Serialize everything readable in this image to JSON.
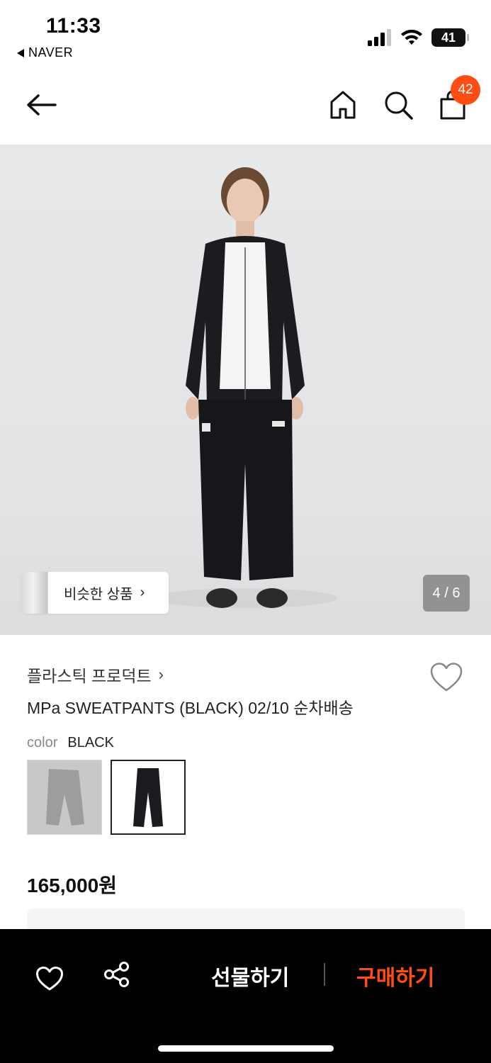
{
  "status_bar": {
    "time": "11:33",
    "back_app": "NAVER",
    "battery": "41"
  },
  "nav": {
    "cart_count": "42",
    "icons": [
      "back-arrow-icon",
      "home-icon",
      "search-icon",
      "shopping-bag-icon"
    ]
  },
  "gallery": {
    "similar_label": "비슷한 상품",
    "similar_chevron": "›",
    "page_indicator": "4 / 6"
  },
  "product": {
    "brand": "플라스틱 프로덕트",
    "brand_chevron": "›",
    "title": "MPa SWEATPANTS (BLACK) 02/10 순차배송",
    "color_key": "color",
    "color_value": "BLACK",
    "swatches": [
      "grey",
      "black"
    ],
    "selected_swatch": "black",
    "price": "165,000원"
  },
  "bottom_bar": {
    "gift_label": "선물하기",
    "buy_label": "구매하기",
    "accent_color": "#ff4d14"
  }
}
